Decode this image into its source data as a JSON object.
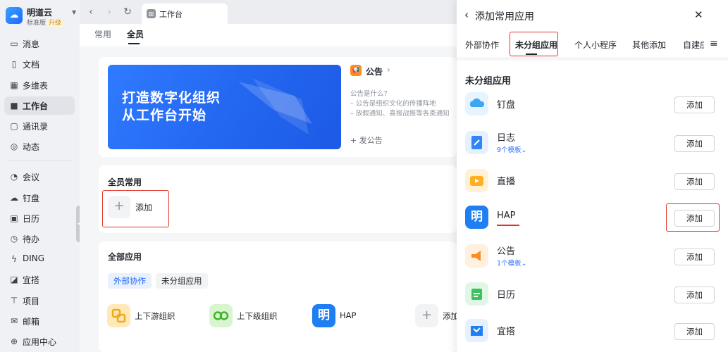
{
  "sidebar": {
    "org_name": "明道云",
    "org_edition": "标准版",
    "upgrade": "升级",
    "items": [
      {
        "label": "消息",
        "icon": "message-icon"
      },
      {
        "label": "文档",
        "icon": "document-icon"
      },
      {
        "label": "多维表",
        "icon": "table-icon"
      },
      {
        "label": "工作台",
        "icon": "workbench-icon",
        "active": true
      },
      {
        "label": "通讯录",
        "icon": "contacts-icon"
      },
      {
        "label": "动态",
        "icon": "moments-icon"
      },
      {
        "label": "会议",
        "icon": "meeting-icon"
      },
      {
        "label": "钉盘",
        "icon": "drive-icon"
      },
      {
        "label": "日历",
        "icon": "calendar-icon"
      },
      {
        "label": "待办",
        "icon": "todo-icon"
      },
      {
        "label": "DING",
        "icon": "ding-icon"
      },
      {
        "label": "宜搭",
        "icon": "yida-icon"
      },
      {
        "label": "项目",
        "icon": "project-icon"
      },
      {
        "label": "邮箱",
        "icon": "mail-icon"
      },
      {
        "label": "应用中心",
        "icon": "app-center-icon"
      }
    ]
  },
  "browser": {
    "tab_title": "工作台"
  },
  "main": {
    "subtabs": [
      "常用",
      "全员"
    ],
    "banner": {
      "line1": "打造数字化组织",
      "line2": "从工作台开始"
    },
    "notice": {
      "title": "公告",
      "line1": "公告是什么?",
      "line2": "– 公告是组织文化的传播阵地",
      "line3": "– 放假通知、喜报战报等各类通知",
      "post": "+ 发公告"
    },
    "common": {
      "title": "全员常用",
      "add_label": "添加"
    },
    "all_apps": {
      "title": "全部应用",
      "chips": [
        "外部协作",
        "未分组应用"
      ],
      "apps": [
        {
          "label": "上下游组织",
          "icon": "upstream-org-icon"
        },
        {
          "label": "上下级组织",
          "icon": "hierarchy-org-icon"
        },
        {
          "label": "HAP",
          "icon": "hap-icon"
        },
        {
          "label": "添加",
          "icon": "add-icon"
        }
      ]
    }
  },
  "panel": {
    "title": "添加常用应用",
    "tabs": [
      "外部协作",
      "未分组应用",
      "个人小程序",
      "其他添加",
      "自建应"
    ],
    "section_title": "未分组应用",
    "add_label": "添加",
    "apps": [
      {
        "name": "钉盘",
        "sub": "",
        "icon": "drive-app-icon",
        "color": "#3aa6f5"
      },
      {
        "name": "日志",
        "sub": "9个模板",
        "icon": "log-app-icon",
        "color": "#2f86f6"
      },
      {
        "name": "直播",
        "sub": "",
        "icon": "live-app-icon",
        "color": "#ffb020"
      },
      {
        "name": "HAP",
        "sub": "",
        "icon": "hap-app-icon",
        "color": "#1f7ef2"
      },
      {
        "name": "公告",
        "sub": "1个模板",
        "icon": "notice-app-icon",
        "color": "#ff8a1f"
      },
      {
        "name": "日历",
        "sub": "",
        "icon": "calendar-app-icon",
        "color": "#3fc15f"
      },
      {
        "name": "宜搭",
        "sub": "",
        "icon": "yida-app-icon",
        "color": "#1f7ef2"
      }
    ]
  }
}
